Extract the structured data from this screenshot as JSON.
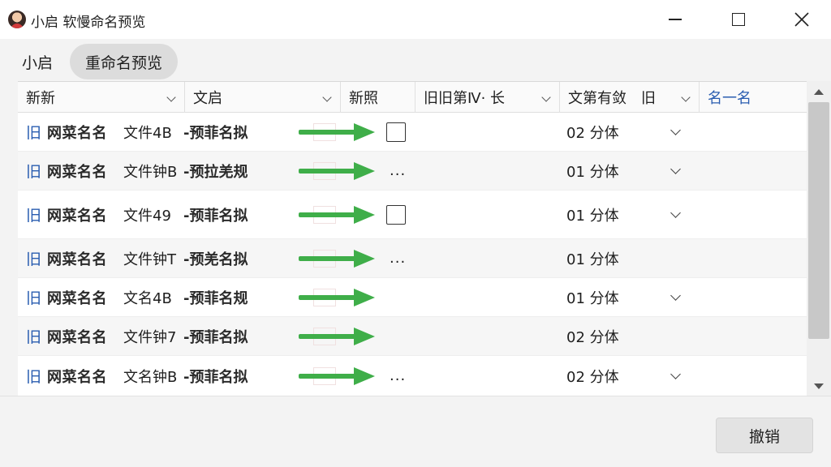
{
  "window": {
    "title": "小启 软慢命名预览"
  },
  "tabs": [
    {
      "label": "小启"
    },
    {
      "label": "重命名预览"
    }
  ],
  "columns": [
    {
      "label": "新新"
    },
    {
      "label": "文启"
    },
    {
      "label": "新照"
    },
    {
      "label": "旧旧第Ⅳ· 长"
    },
    {
      "label": "文第有敛　旧"
    },
    {
      "label": "名一名"
    }
  ],
  "rows": [
    {
      "tag": "旧",
      "old_name": "网菜名名",
      "file_name": "文件4B",
      "new_name": "-预菲名拟",
      "trailing": "checkbox",
      "count": "02 分体",
      "has_chevron": true
    },
    {
      "tag": "旧",
      "old_name": "网菜名名",
      "file_name": "文件钟B",
      "new_name": "-预拉羌规",
      "trailing": "...",
      "count": "01 分体",
      "has_chevron": true
    },
    {
      "tag": "旧",
      "old_name": "网菜名名",
      "file_name": "文件49",
      "new_name": "-预菲名拟",
      "trailing": "checkbox",
      "count": "01 分体",
      "has_chevron": true
    },
    {
      "tag": "旧",
      "old_name": "网菜名名",
      "file_name": "文件钟T",
      "new_name": "-预羌名拟",
      "trailing": "...",
      "count": "01 分体",
      "has_chevron": false
    },
    {
      "tag": "旧",
      "old_name": "网菜名名",
      "file_name": "文名4B",
      "new_name": "-预菲名规",
      "trailing": "",
      "count": "01 分体",
      "has_chevron": true
    },
    {
      "tag": "旧",
      "old_name": "网菜名名",
      "file_name": "文件钟7",
      "new_name": "-预菲名拟",
      "trailing": "",
      "count": "02 分体",
      "has_chevron": false
    },
    {
      "tag": "旧",
      "old_name": "网菜名名",
      "file_name": "文名钟B",
      "new_name": "-预菲名拟",
      "trailing": "...",
      "count": "02 分体",
      "has_chevron": true
    }
  ],
  "footer": {
    "cancel_label": "撤销"
  },
  "colors": {
    "accent_blue": "#2a5db0",
    "arrow_green": "#3fae49"
  },
  "icons": {
    "app": "app-avatar-icon",
    "row_arrow": "right-arrow-icon",
    "dropdown": "chevron-down-icon"
  }
}
